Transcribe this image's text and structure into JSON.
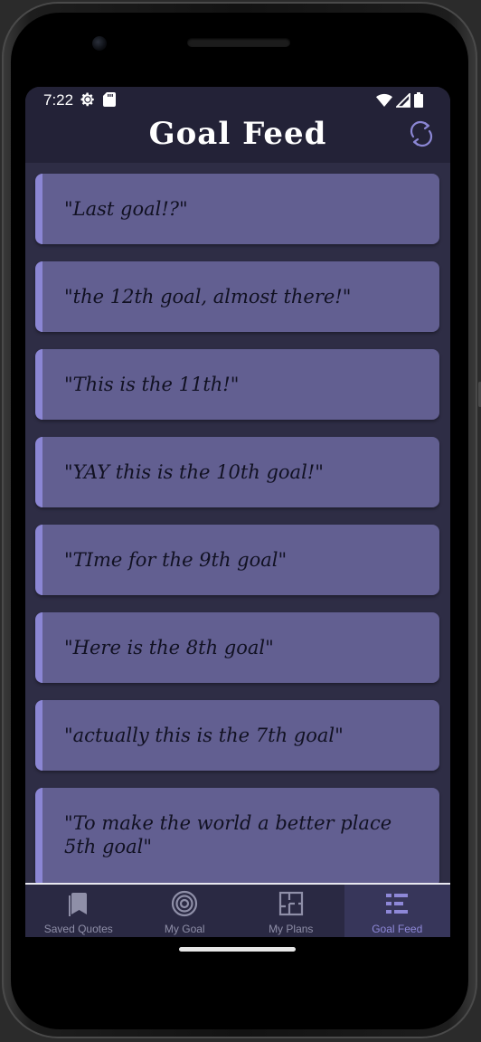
{
  "status_bar": {
    "time": "7:22",
    "left_icons": [
      "gear-icon",
      "sd-card-icon"
    ],
    "right_icons": [
      "wifi-icon",
      "signal-icon",
      "battery-icon"
    ]
  },
  "app_bar": {
    "title": "Goal Feed",
    "refresh_icon": "refresh-icon"
  },
  "colors": {
    "screen_bg": "#2e2d45",
    "bar_bg": "#232237",
    "card_bg": "#625f91",
    "card_accent": "#8b86d4",
    "active_nav": "#8e88d8"
  },
  "feed": {
    "items": [
      {
        "quote": "\"Last goal!?\""
      },
      {
        "quote": "\"the 12th goal, almost there!\""
      },
      {
        "quote": "\"This is the 11th!\""
      },
      {
        "quote": "\"YAY this is the 10th goal!\""
      },
      {
        "quote": "\"TIme for the 9th goal\""
      },
      {
        "quote": "\"Here is the 8th goal\""
      },
      {
        "quote": "\"actually this is the 7th goal\""
      },
      {
        "quote": "\"To make the world a better place 5th goal\""
      }
    ]
  },
  "bottom_nav": {
    "items": [
      {
        "label": "Saved Quotes",
        "icon": "bookmark-icon",
        "active": false
      },
      {
        "label": "My Goal",
        "icon": "target-icon",
        "active": false
      },
      {
        "label": "My Plans",
        "icon": "floor-plan-icon",
        "active": false
      },
      {
        "label": "Goal Feed",
        "icon": "feed-list-icon",
        "active": true
      }
    ]
  }
}
